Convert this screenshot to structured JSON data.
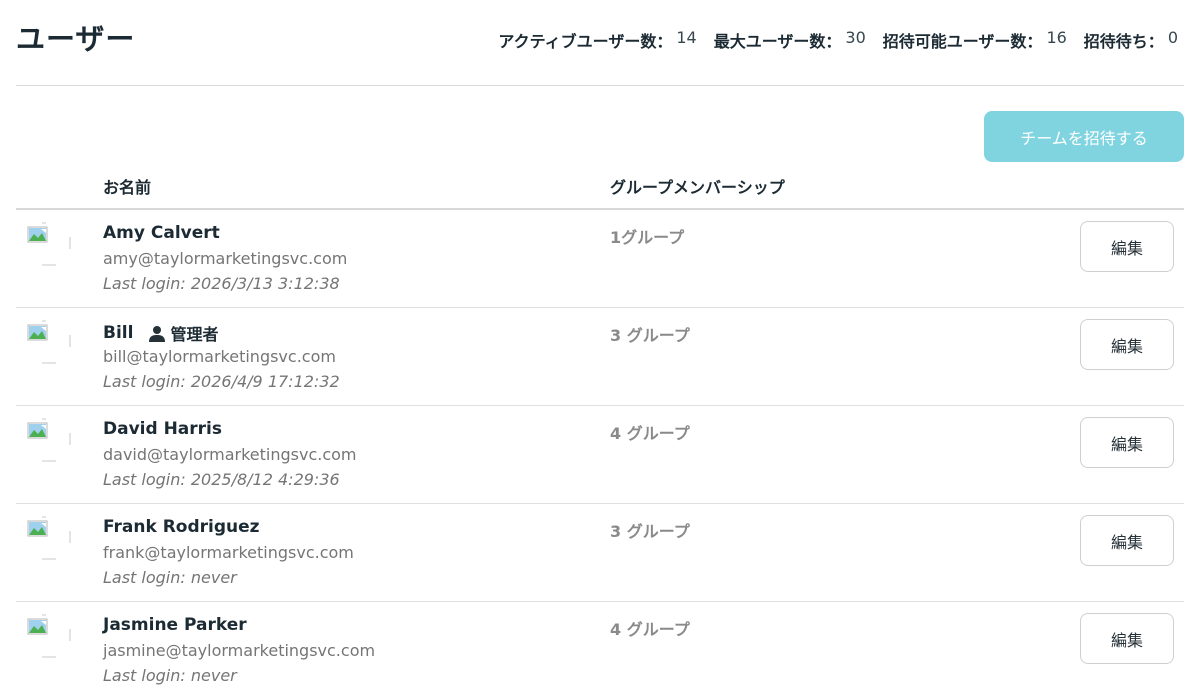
{
  "page": {
    "title": "ユーザー"
  },
  "stats": [
    {
      "label": "アクティブユーザー数：",
      "value": "14"
    },
    {
      "label": "最大ユーザー数：",
      "value": "30"
    },
    {
      "label": "招待可能ユーザー数：",
      "value": "16"
    },
    {
      "label": "招待待ち：",
      "value": "0"
    }
  ],
  "actions": {
    "invite_label": "チームを招待する"
  },
  "table": {
    "headers": {
      "name": "お名前",
      "groups": "グループメンバーシップ"
    },
    "edit_label": "編集",
    "admin_label": "管理者",
    "users": [
      {
        "name": "Amy Calvert",
        "email": "amy@taylormarketingsvc.com",
        "last_login": "Last login: 2026/3/13 3:12:38",
        "groups": "1グループ",
        "is_admin": false
      },
      {
        "name": "Bill",
        "email": "bill@taylormarketingsvc.com",
        "last_login": "Last login: 2026/4/9 17:12:32",
        "groups": "3 グループ",
        "is_admin": true
      },
      {
        "name": "David Harris",
        "email": "david@taylormarketingsvc.com",
        "last_login": "Last login: 2025/8/12 4:29:36",
        "groups": "4 グループ",
        "is_admin": false
      },
      {
        "name": "Frank Rodriguez",
        "email": "frank@taylormarketingsvc.com",
        "last_login": "Last login: never",
        "groups": "3 グループ",
        "is_admin": false
      },
      {
        "name": "Jasmine Parker",
        "email": "jasmine@taylormarketingsvc.com",
        "last_login": "Last login: never",
        "groups": "4 グループ",
        "is_admin": false
      }
    ]
  }
}
